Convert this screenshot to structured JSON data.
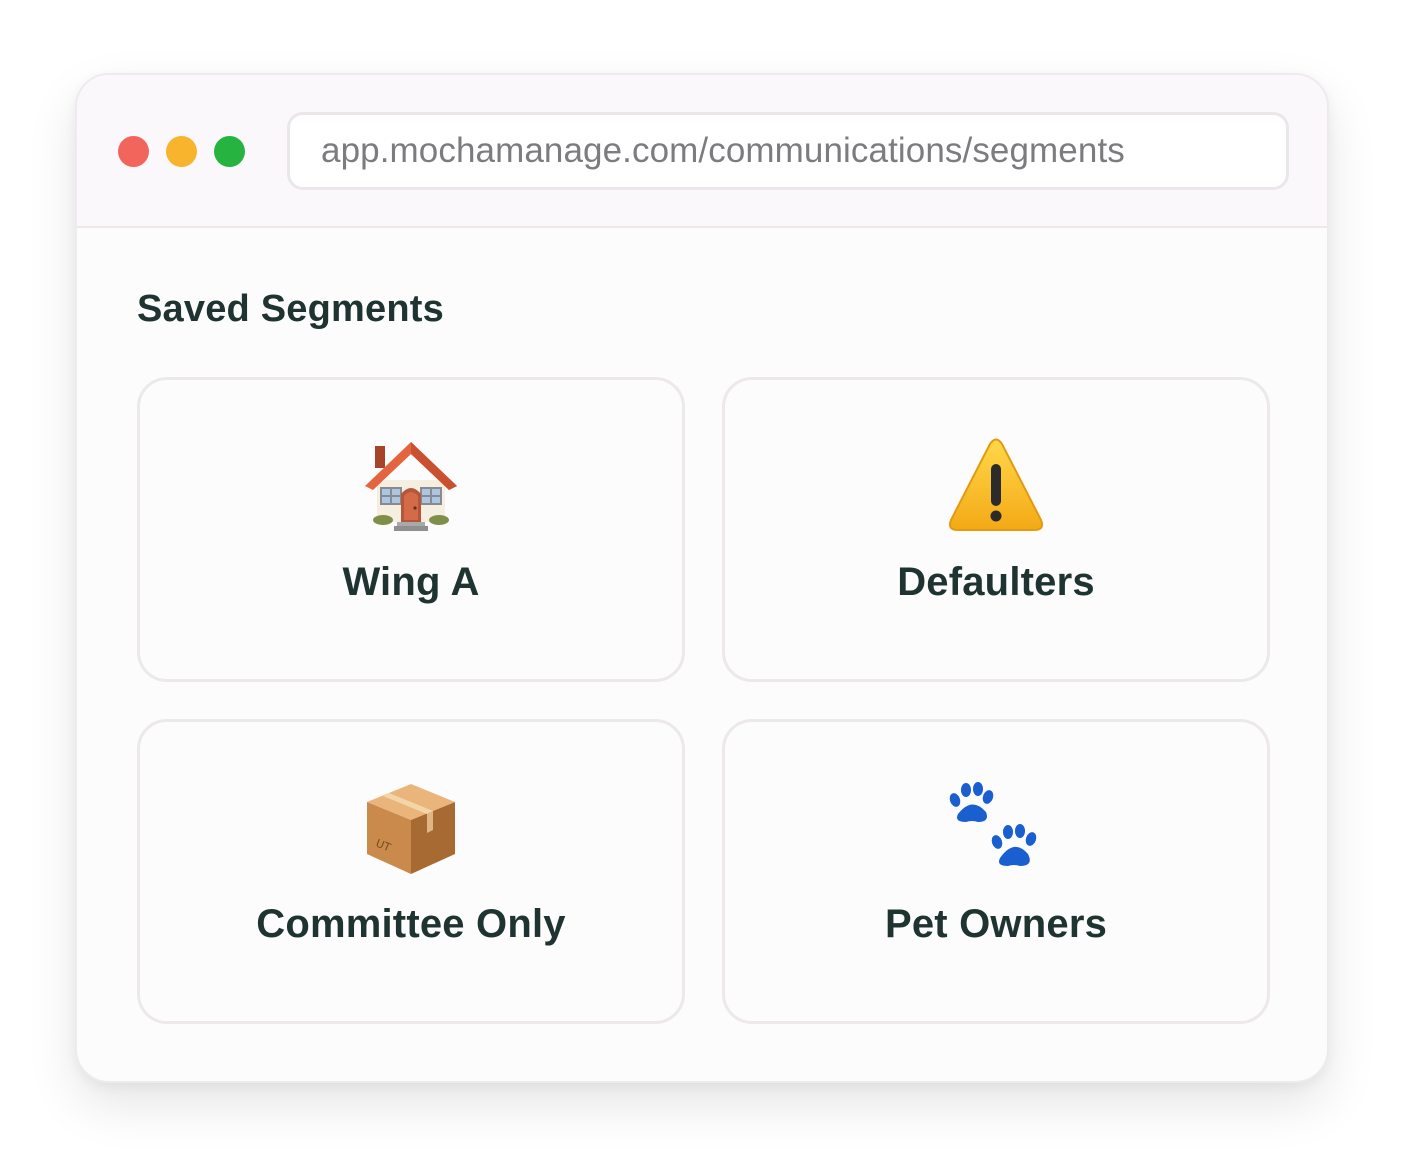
{
  "browser": {
    "url": "app.mochamanage.com/communications/segments",
    "controls": [
      {
        "name": "close",
        "color": "#f1655c"
      },
      {
        "name": "minimize",
        "color": "#f7b42c"
      },
      {
        "name": "maximize",
        "color": "#27b340"
      }
    ]
  },
  "page": {
    "title": "Saved Segments"
  },
  "segments": [
    {
      "label": "Wing A",
      "icon": "house-icon"
    },
    {
      "label": "Defaulters",
      "icon": "warning-icon"
    },
    {
      "label": "Committee Only",
      "icon": "package-icon"
    },
    {
      "label": "Pet Owners",
      "icon": "paw-prints-icon"
    }
  ],
  "colors": {
    "text_dark": "#1f3431",
    "url_text": "#7c7b80",
    "border": "#ece8ec",
    "paw_blue": "#1a5fd0"
  }
}
